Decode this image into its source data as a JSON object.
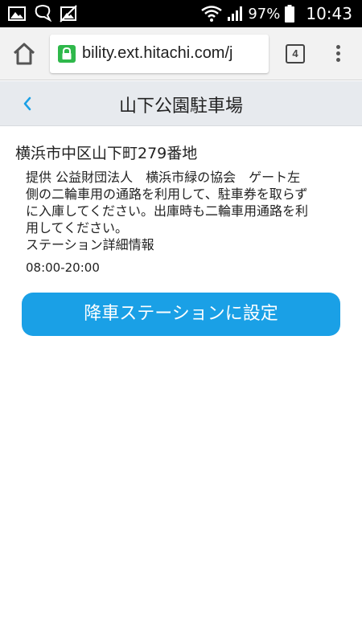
{
  "status_bar": {
    "battery_percent": "97%",
    "time": "10:43",
    "icons": [
      "image-icon",
      "chat-icon",
      "no-image-icon",
      "wifi-icon",
      "signal-icon",
      "battery-icon"
    ]
  },
  "browser": {
    "url": "bility.ext.hitachi.com/j",
    "tab_count": "4",
    "secure": true,
    "lock_color": "#2fb84b"
  },
  "header": {
    "title": "山下公園駐車場",
    "back_icon": "chevron-left-icon",
    "accent_color": "#1aa0e6"
  },
  "station": {
    "address": "横浜市中区山下町279番地",
    "description_lines": [
      "提供 公益財団法人　横浜市緑の協会　ゲート左",
      "側の二輪車用の通路を利用して、駐車券を取らず",
      "に入庫してください。出庫時も二輪車用通路を利",
      "用してください。",
      "ステーション詳細情報"
    ],
    "hours": "08:00-20:00",
    "button_label": "降車ステーションに設定"
  }
}
